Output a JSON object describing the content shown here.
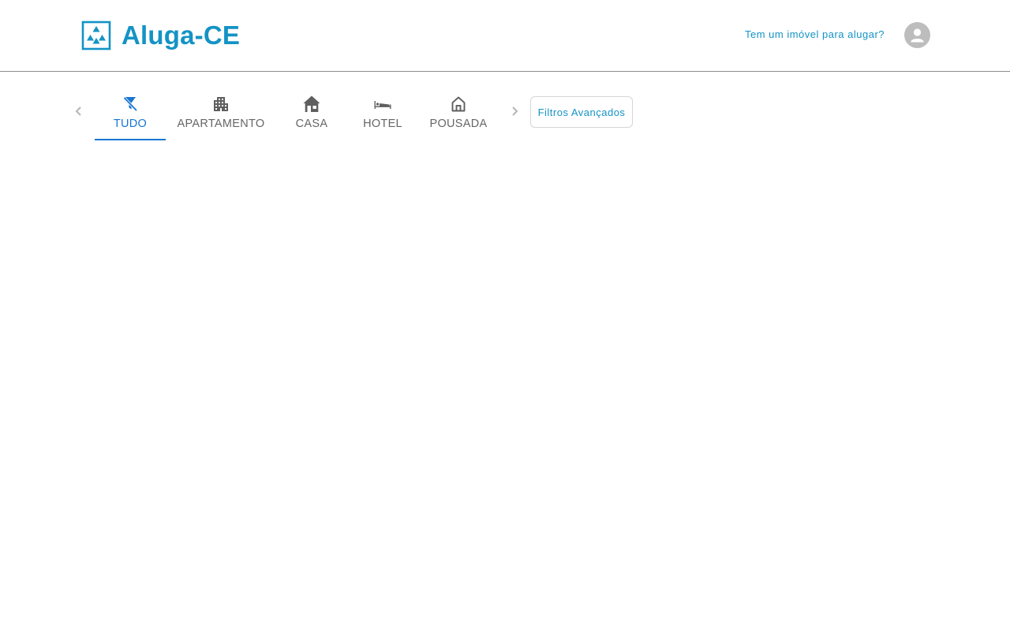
{
  "brand": {
    "title": "Aluga-CE",
    "icon": "logo-icon",
    "color": "#1493c5"
  },
  "header": {
    "host_link": "Tem um imóvel para alugar?",
    "avatar_icon": "account-icon"
  },
  "categories": {
    "active_color": "#1976d2",
    "inactive_color": "#666666",
    "items": [
      {
        "label": "TUDO",
        "icon": "filter-off-icon",
        "active": true
      },
      {
        "label": "APARTAMENTO",
        "icon": "apartment-icon",
        "active": false
      },
      {
        "label": "CASA",
        "icon": "house-icon",
        "active": false
      },
      {
        "label": "HOTEL",
        "icon": "hotel-bed-icon",
        "active": false
      },
      {
        "label": "POUSADA",
        "icon": "home-outline-icon",
        "active": false
      }
    ],
    "prev_icon": "chevron-left-icon",
    "next_icon": "chevron-right-icon"
  },
  "filters": {
    "advanced_label": "Filtros Avançados"
  }
}
